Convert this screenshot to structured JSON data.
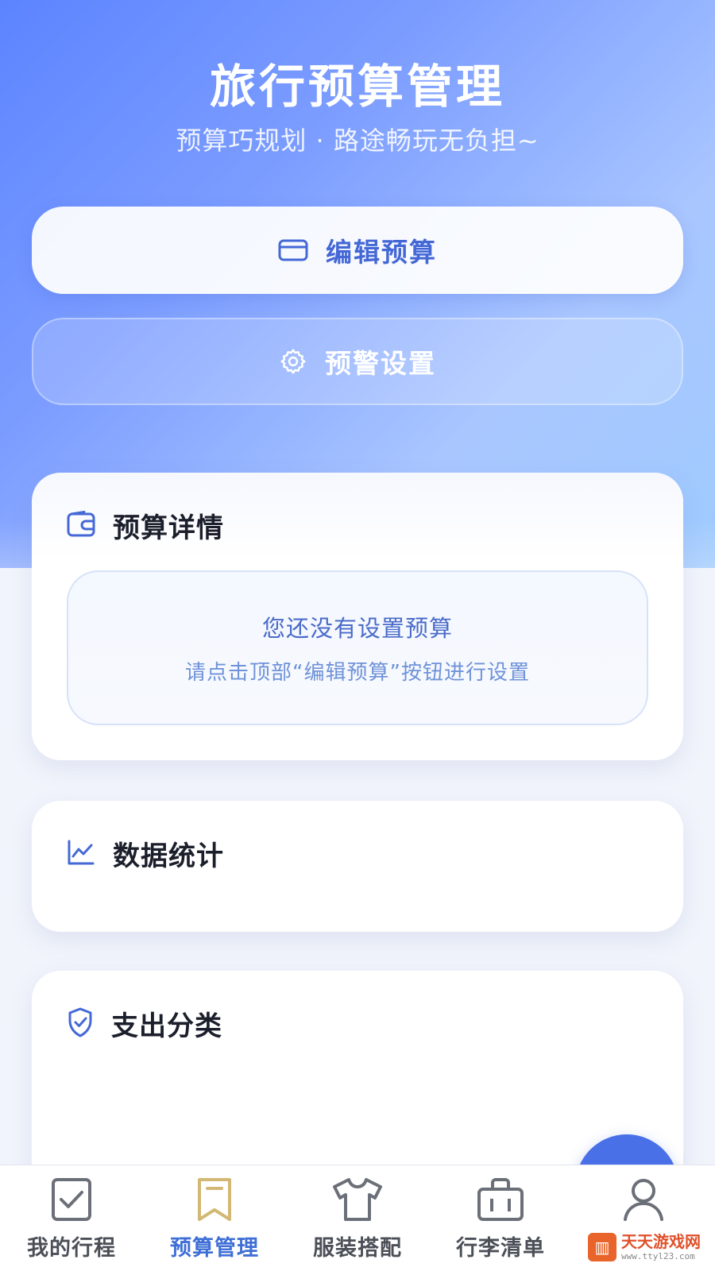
{
  "header": {
    "title": "旅行预算管理",
    "subtitle": "预算巧规划 · 路途畅玩无负担~"
  },
  "actions": {
    "edit_budget": {
      "label": "编辑预算",
      "icon": "card-icon"
    },
    "alert_settings": {
      "label": "预警设置",
      "icon": "gear-icon"
    }
  },
  "budget_card": {
    "title": "预算详情",
    "icon": "wallet-icon",
    "empty_title": "您还没有设置预算",
    "empty_hint": "请点击顶部“编辑预算”按钮进行设置"
  },
  "stats_card": {
    "title": "数据统计",
    "icon": "line-chart-icon"
  },
  "category_card": {
    "title": "支出分类",
    "icon": "shield-check-icon"
  },
  "tabbar": {
    "items": [
      {
        "label": "我的行程",
        "icon": "checklist-icon",
        "active": false
      },
      {
        "label": "预算管理",
        "icon": "bookmark-icon",
        "active": true
      },
      {
        "label": "服装搭配",
        "icon": "tshirt-icon",
        "active": false
      },
      {
        "label": "行李清单",
        "icon": "suitcase-icon",
        "active": false
      },
      {
        "label": "",
        "icon": "user-icon",
        "active": false
      }
    ]
  },
  "watermark": {
    "name": "天天游戏网",
    "url": "www.ttyl23.com"
  },
  "colors": {
    "accent": "#4468d6",
    "active_tab": "#3f6fd6",
    "header_gradient_start": "#5c84ff",
    "header_gradient_end": "#9fcbff"
  }
}
